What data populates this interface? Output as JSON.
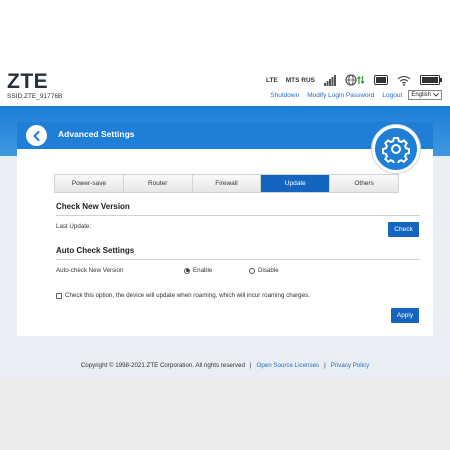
{
  "header": {
    "logo": "ZTE",
    "ssid": "SSID:ZTE_91776B",
    "network_type": "LTE",
    "operator": "MTS RUS",
    "links": {
      "shutdown": "Shutdown",
      "modify_login_password": "Modify Login Password",
      "logout": "Logout"
    },
    "language": "English"
  },
  "panel": {
    "title": "Advanced Settings",
    "tabs": [
      {
        "label": "Power-save",
        "active": false
      },
      {
        "label": "Router",
        "active": false
      },
      {
        "label": "Firewall",
        "active": false
      },
      {
        "label": "Update",
        "active": true
      },
      {
        "label": "Others",
        "active": false
      }
    ],
    "check_new_version": {
      "heading": "Check New Version",
      "last_update_label": "Last Update:",
      "check_button": "Check"
    },
    "auto_check": {
      "heading": "Auto Check Settings",
      "label": "Auto-check New Version",
      "options": [
        {
          "label": "Enable",
          "selected": true
        },
        {
          "label": "Disable",
          "selected": false
        }
      ],
      "roaming_checkbox": {
        "label": "Check this option, the device will update when roaming, which will incur roaming charges.",
        "checked": false
      },
      "apply_button": "Apply"
    }
  },
  "footer": {
    "copyright": "Copyright © 1998-2021 ZTE Corporation. All rights reserved",
    "separator": "|",
    "open_source_licenses": "Open Source Licenses",
    "privacy_policy": "Privacy Policy"
  },
  "colors": {
    "primary_blue": "#1f7fd7",
    "tab_active": "#1565c0",
    "link": "#1f6fc4"
  }
}
